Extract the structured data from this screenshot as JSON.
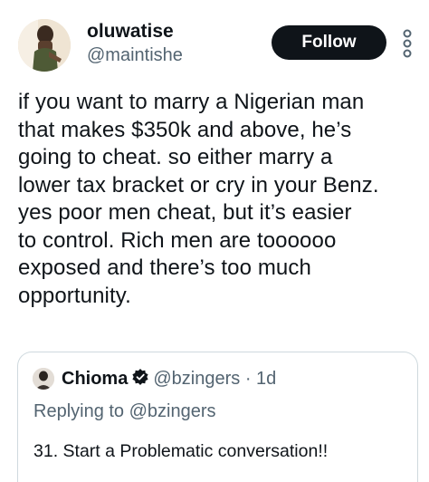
{
  "author": {
    "display_name": "oluwatise",
    "handle": "@maintishe",
    "avatar_icon": "user-photo-avatar"
  },
  "follow_label": "Follow",
  "more_icon": "more-vertical-icon",
  "tweet": {
    "lines": [
      "if you want to marry a Nigerian man",
      "that makes $350k and above, he’s",
      "going to cheat. so either marry a",
      "lower tax bracket or cry in your Benz.",
      "yes poor men cheat, but it’s easier",
      "to control. Rich men are toooooo",
      "exposed and there’s too much",
      "opportunity."
    ]
  },
  "quote": {
    "display_name": "Chioma",
    "badge_icon": "verified-badge-icon",
    "handle": "@bzingers",
    "separator": "·",
    "time": "1d",
    "replying_to": "Replying to @bzingers",
    "text": "31. Start a Problematic conversation!!"
  },
  "colors": {
    "text_primary": "#0f1419",
    "text_secondary": "#536471",
    "border": "#cfd9de",
    "button_bg": "#0f1419",
    "button_text": "#ffffff"
  }
}
